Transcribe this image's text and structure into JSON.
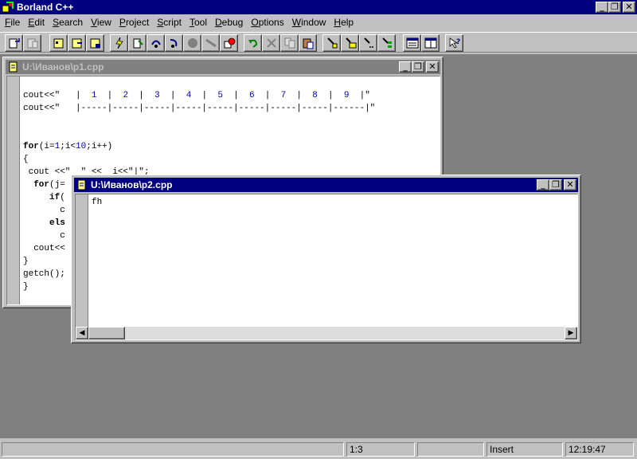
{
  "app": {
    "title": "Borland C++",
    "caption_buttons": {
      "minimize": "_",
      "restore": "❐",
      "close": "✕"
    }
  },
  "menu": [
    {
      "label": "File",
      "accel": "F",
      "rest": "ile"
    },
    {
      "label": "Edit",
      "accel": "E",
      "rest": "dit"
    },
    {
      "label": "Search",
      "accel": "S",
      "rest": "earch"
    },
    {
      "label": "View",
      "accel": "V",
      "rest": "iew"
    },
    {
      "label": "Project",
      "accel": "P",
      "rest": "roject"
    },
    {
      "label": "Script",
      "accel": "S",
      "rest": "cript"
    },
    {
      "label": "Tool",
      "accel": "T",
      "rest": "ool"
    },
    {
      "label": "Debug",
      "accel": "D",
      "rest": "ebug"
    },
    {
      "label": "Options",
      "accel": "O",
      "rest": "ptions"
    },
    {
      "label": "Window",
      "accel": "W",
      "rest": "indow"
    },
    {
      "label": "Help",
      "accel": "H",
      "rest": "elp"
    }
  ],
  "toolbar": {
    "icons": [
      "open-file-icon",
      "save-file-icon",
      "new-project-icon",
      "open-project-icon",
      "save-project-icon",
      "make-icon",
      "compile-icon",
      "step-over-icon",
      "trace-into-icon",
      "run-icon",
      "stop-icon",
      "breakpoint-icon",
      "undo-icon",
      "cut-icon",
      "copy-icon",
      "paste-icon",
      "find-icon",
      "replace-icon",
      "find-next-icon",
      "browse-icon",
      "window-tile-icon",
      "window-cascade-icon",
      "context-help-icon"
    ]
  },
  "windows": {
    "p1": {
      "title": "U:\\Иванов\\p1.cpp",
      "code": [
        "",
        "cout<<\"   |  1  |  2  |  3  |  4  |  5  |  6  |  7  |  8  |  9  |\"",
        "cout<<\"   |-----|-----|-----|-----|-----|-----|-----|-----|------|\"",
        "",
        "",
        "for(i=1;i<10;i++)",
        "{",
        " cout <<\"  \" <<  i<<\"|\";",
        "  for(j=",
        "     if(",
        "       c",
        "     els",
        "       c",
        "  cout<<",
        "}",
        "getch();",
        "}"
      ]
    },
    "p2": {
      "title": "U:\\Иванов\\p2.cpp",
      "code": [
        "fh"
      ]
    }
  },
  "status": {
    "message": "",
    "position": "1:3",
    "modified": "",
    "mode": "Insert",
    "time": "12:19:47"
  }
}
